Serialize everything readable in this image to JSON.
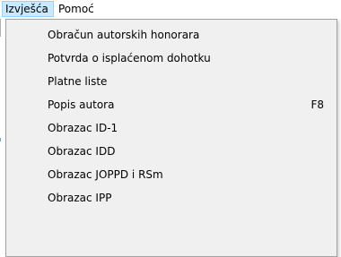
{
  "menubar": {
    "items": [
      {
        "label": "Izvješća",
        "active": true
      },
      {
        "label": "Pomoć",
        "active": false
      }
    ]
  },
  "dropdown": {
    "items": [
      {
        "label": "Obračun autorskih honorara",
        "shortcut": ""
      },
      {
        "label": "Potvrda o isplaćenom dohotku",
        "shortcut": ""
      },
      {
        "label": "Platne liste",
        "shortcut": ""
      },
      {
        "label": "Popis autora",
        "shortcut": "F8"
      },
      {
        "label": "Obrazac ID-1",
        "shortcut": ""
      },
      {
        "label": "Obrazac IDD",
        "shortcut": ""
      },
      {
        "label": "Obrazac JOPPD i RSm",
        "shortcut": ""
      },
      {
        "label": "Obrazac IPP",
        "shortcut": ""
      },
      {
        "label": "",
        "shortcut": ""
      }
    ]
  },
  "colors": {
    "active_menubar_bg": "#cce8ff",
    "active_menubar_border": "#99d1ff",
    "dropdown_bg": "#f0f0f0",
    "dropdown_border": "#a0a0a0"
  }
}
